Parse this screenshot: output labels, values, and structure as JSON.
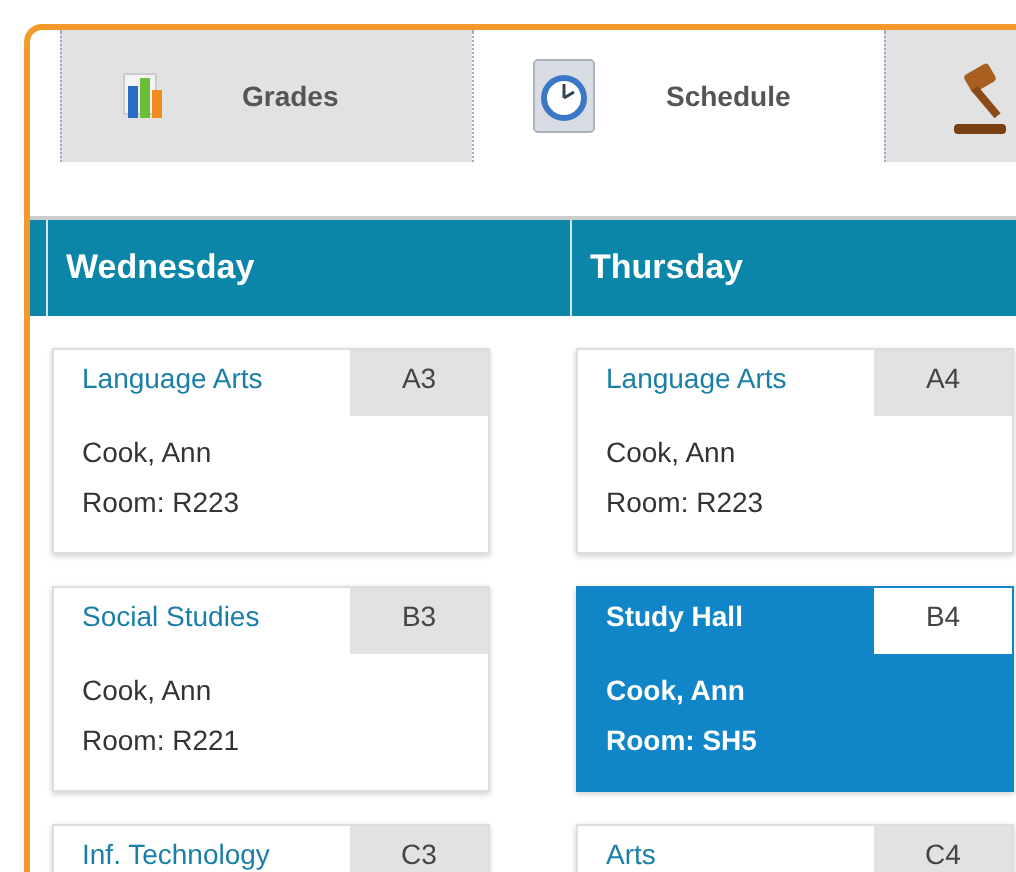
{
  "tabs": [
    {
      "label": "Grades",
      "kind": "grades",
      "selected": false
    },
    {
      "label": "Schedule",
      "kind": "schedule",
      "selected": true
    },
    {
      "kind": "gavel",
      "selected": false
    }
  ],
  "days": [
    {
      "name": "Wednesday",
      "classes": [
        {
          "subject": "Language Arts",
          "period": "A3",
          "teacher": "Cook, Ann",
          "room": "Room: R223",
          "selected": false
        },
        {
          "subject": "Social Studies",
          "period": "B3",
          "teacher": "Cook, Ann",
          "room": "Room: R221",
          "selected": false
        },
        {
          "subject": "Inf. Technology",
          "period": "C3",
          "selected": false
        }
      ]
    },
    {
      "name": "Thursday",
      "classes": [
        {
          "subject": "Language Arts",
          "period": "A4",
          "teacher": "Cook, Ann",
          "room": "Room: R223",
          "selected": false
        },
        {
          "subject": "Study Hall",
          "period": "B4",
          "teacher": "Cook, Ann",
          "room": "Room: SH5",
          "selected": true
        },
        {
          "subject": "Arts",
          "period": "C4",
          "selected": false
        }
      ]
    }
  ]
}
